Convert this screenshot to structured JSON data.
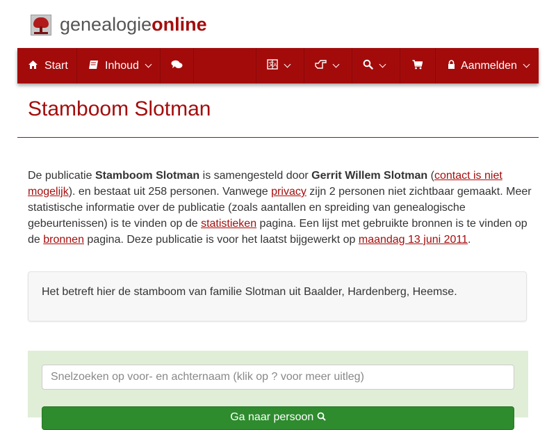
{
  "header": {
    "logo_text_plain": "genealogie",
    "logo_text_bold": "online"
  },
  "nav": {
    "start_label": "Start",
    "start_icon": "home-icon",
    "inhoud_label": "Inhoud",
    "inhoud_icon": "book-icon",
    "chat_icon": "comments-icon",
    "language_icon": "translate-icon",
    "share_icon": "hand-point-icon",
    "search_icon": "search-icon",
    "cart_icon": "cart-icon",
    "login_label": "Aanmelden",
    "login_icon": "lock-icon"
  },
  "page": {
    "title": "Stamboom Slotman"
  },
  "intro": {
    "t1": "De publicatie ",
    "pub_name": "Stamboom Slotman",
    "t2": " is samengesteld door ",
    "author": "Gerrit Willem Slotman",
    "t3": " (",
    "contact_link": "contact is niet mogelijk",
    "t4": "). en bestaat uit 258 personen. Vanwege ",
    "privacy_link": "privacy",
    "t5": " zijn 2 personen niet zichtbaar gemaakt. Meer statistische informatie over de publicatie (zoals aantallen en spreiding van genealogische gebeurtenissen) is te vinden op de ",
    "stats_link": "statistieken",
    "t6": " pagina. Een lijst met gebruikte bronnen is te vinden op de ",
    "sources_link": "bronnen",
    "t7": " pagina. Deze publicatie is voor het laatst bijgewerkt op ",
    "date_link": "maandag 13 juni 2011",
    "t8": "."
  },
  "description": "Het betreft hier de stamboom van familie Slotman uit Baalder, Hardenberg, Heemse.",
  "search": {
    "placeholder": "Snelzoeken op voor- en achternaam (klik op ? voor meer uitleg)",
    "value": "",
    "button_label": "Ga naar persoon"
  },
  "colors": {
    "brand": "#a30b0b",
    "search_bg": "#e0eed8",
    "button": "#2e8b2e"
  }
}
